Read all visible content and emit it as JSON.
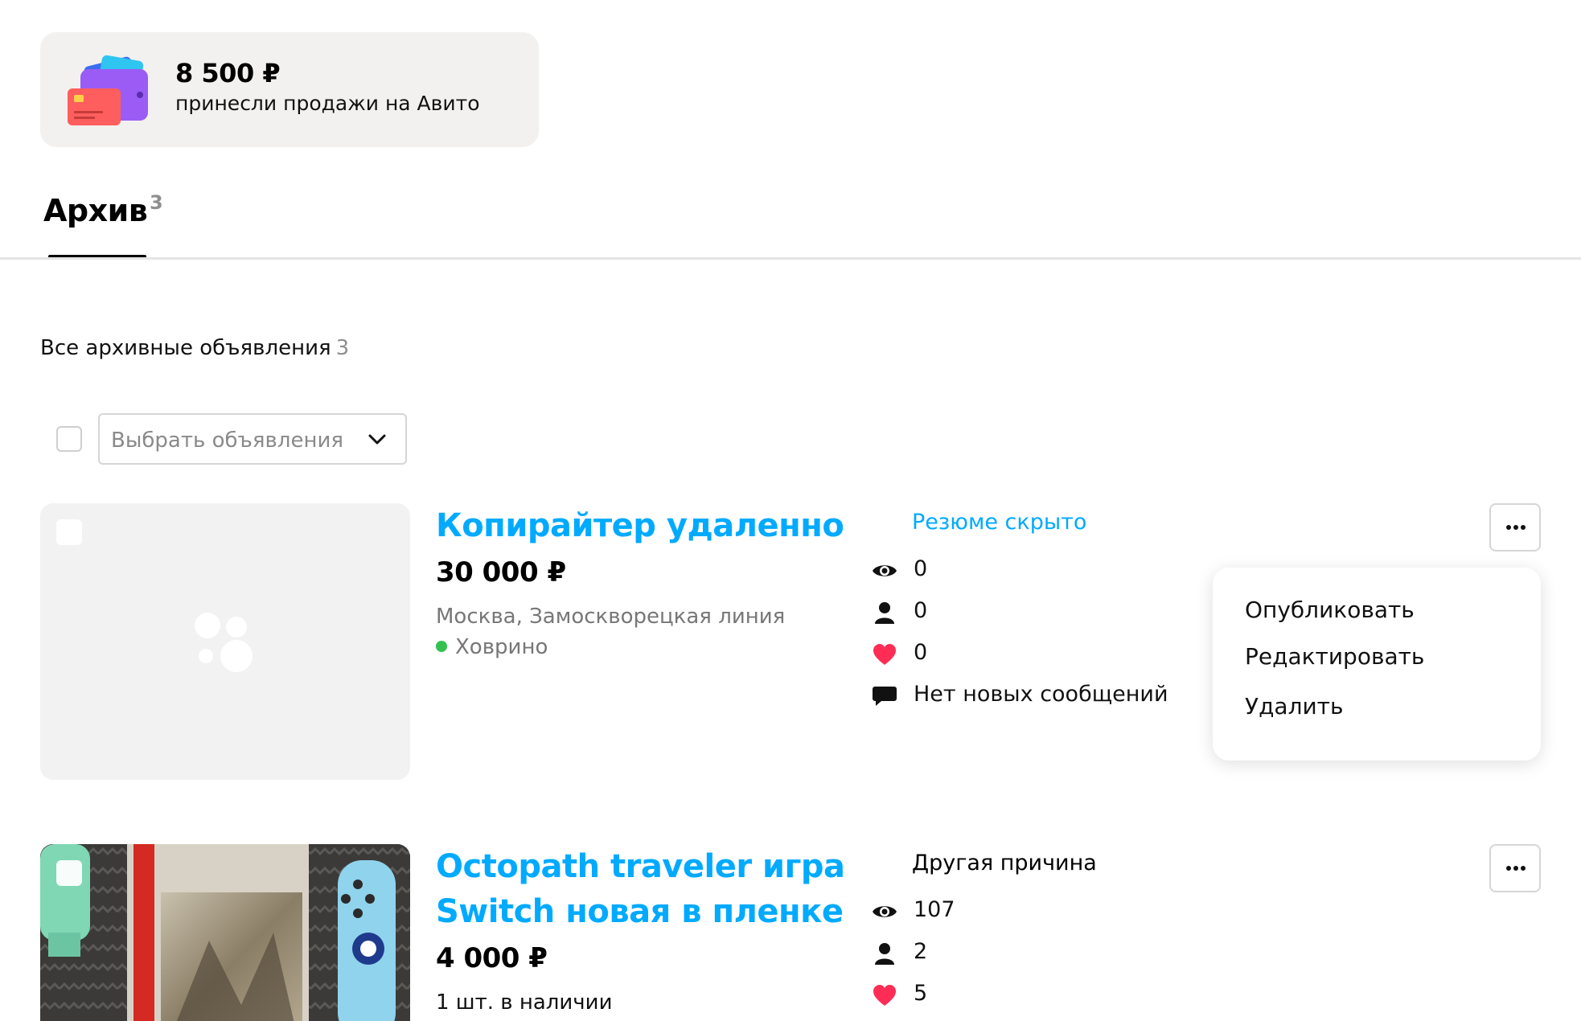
{
  "sales": {
    "amount": "8 500 ₽",
    "caption": "принесли продажи на Авито",
    "icon": "wallet-icon"
  },
  "tabs": [
    {
      "label": "Архив",
      "count": "3",
      "active": true
    }
  ],
  "section": {
    "title": "Все архивные объявления",
    "count": "3"
  },
  "bulk": {
    "select_placeholder": "Выбрать объявления"
  },
  "listings": [
    {
      "title": "Копирайтер удаленно",
      "price": "30 000 ₽",
      "location": "Москва, Замоскворецкая линия",
      "station": "Ховрино",
      "status": "Резюме скрыто",
      "views": "0",
      "contacts": "0",
      "favorites": "0",
      "messages": "Нет новых сообщений",
      "image": "placeholder-logo"
    },
    {
      "title_line1": "Octopath traveler игра",
      "title_line2": "Switch новая в пленке",
      "price": "4 000 ₽",
      "stock": "1 шт. в наличии",
      "status": "Другая причина",
      "views": "107",
      "contacts": "2",
      "favorites": "5",
      "image": "nintendo-switch-game-photo"
    }
  ],
  "menu": {
    "items": [
      "Опубликовать",
      "Редактировать",
      "Удалить"
    ]
  },
  "colors": {
    "accent": "#00aaff",
    "favorite": "#ff2d55",
    "online": "#35c14f",
    "card_bg": "#f2f1ef"
  }
}
